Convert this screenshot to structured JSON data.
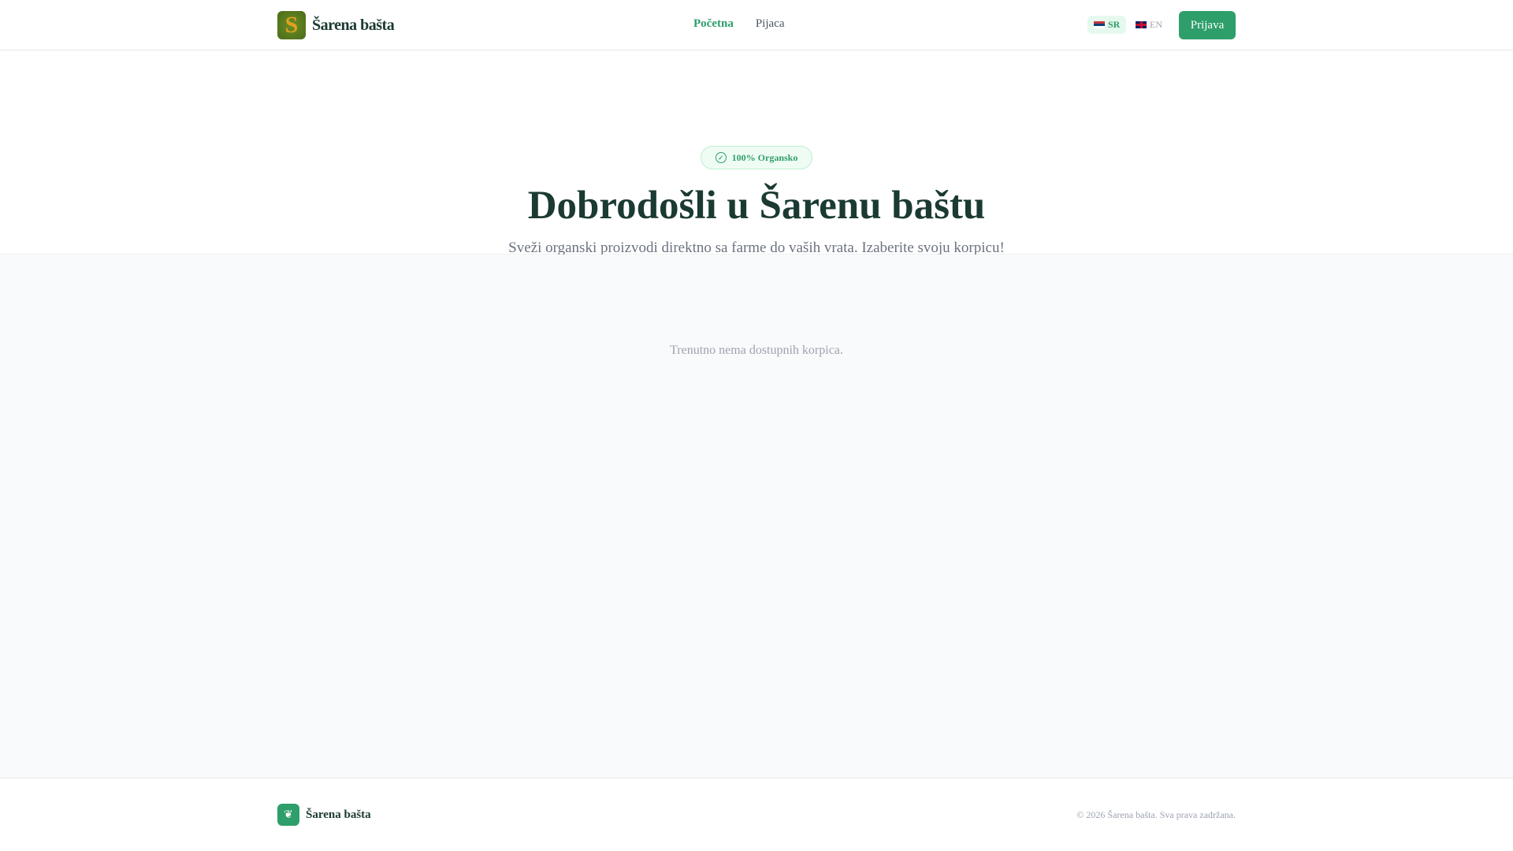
{
  "header": {
    "brand": "Šarena bašta",
    "nav": [
      {
        "label": "Početna",
        "active": true
      },
      {
        "label": "Pijaca",
        "active": false
      }
    ],
    "languages": [
      {
        "code": "SR",
        "active": true
      },
      {
        "code": "EN",
        "active": false
      }
    ],
    "login": "Prijava"
  },
  "hero": {
    "badge": "100% Organsko",
    "title": "Dobrodošli u Šarenu baštu",
    "subtitle": "Sveži organski proizvodi direktno sa farme do vaših vrata. Izaberite svoju korpicu!"
  },
  "main": {
    "empty": "Trenutno nema dostupnih korpica."
  },
  "footer": {
    "brand": "Šarena bašta",
    "copyright": "© 2026 Šarena bašta. Sva prava zadržana."
  },
  "colors": {
    "accent": "#2e9e6b",
    "text": "#1a3a32"
  }
}
